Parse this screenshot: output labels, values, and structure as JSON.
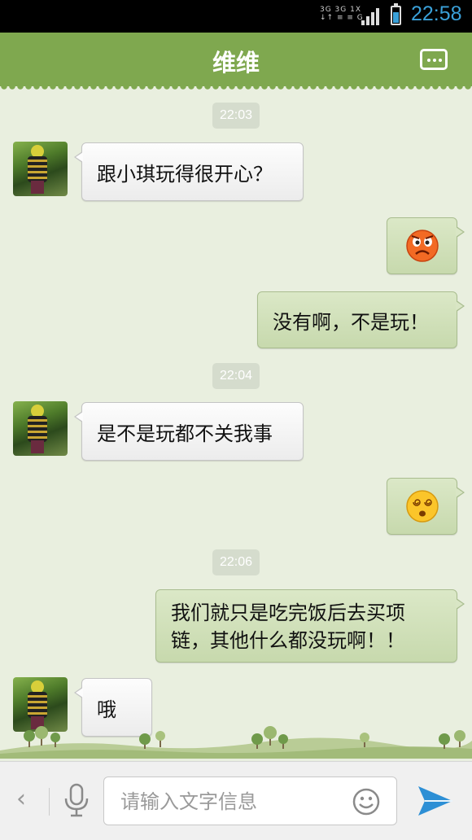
{
  "status_bar": {
    "network_top": "3G 3G 1X",
    "network_bottom": "↓↑ ≡ ≡  G",
    "time": "22:58"
  },
  "header": {
    "title": "维维"
  },
  "messages": [
    {
      "type": "timestamp",
      "text": "22:03"
    },
    {
      "type": "text",
      "side": "left",
      "text": "跟小琪玩得很开心？"
    },
    {
      "type": "emoji",
      "side": "right",
      "icon": "angry-face-icon"
    },
    {
      "type": "text",
      "side": "right",
      "text": "没有啊，不是玩！"
    },
    {
      "type": "timestamp",
      "text": "22:04"
    },
    {
      "type": "text",
      "side": "left",
      "text": "是不是玩都不关我事"
    },
    {
      "type": "emoji",
      "side": "right",
      "icon": "dizzy-face-icon"
    },
    {
      "type": "timestamp",
      "text": "22:06"
    },
    {
      "type": "text",
      "side": "right",
      "lines": [
        "我们就只是吃完饭后去买项",
        "链，其他什么都没玩啊！！"
      ]
    },
    {
      "type": "text",
      "side": "left",
      "text": "哦"
    }
  ],
  "input_bar": {
    "placeholder": "请输入文字信息",
    "icons": [
      "back-arrow-icon",
      "microphone-icon",
      "smiley-icon",
      "send-icon"
    ]
  },
  "colors": {
    "header": "#7fa84f",
    "background": "#e9efdf",
    "bubble_right": "#d2e2bb",
    "bubble_left": "#f6f6f6",
    "time_accent": "#3aa0d8"
  }
}
